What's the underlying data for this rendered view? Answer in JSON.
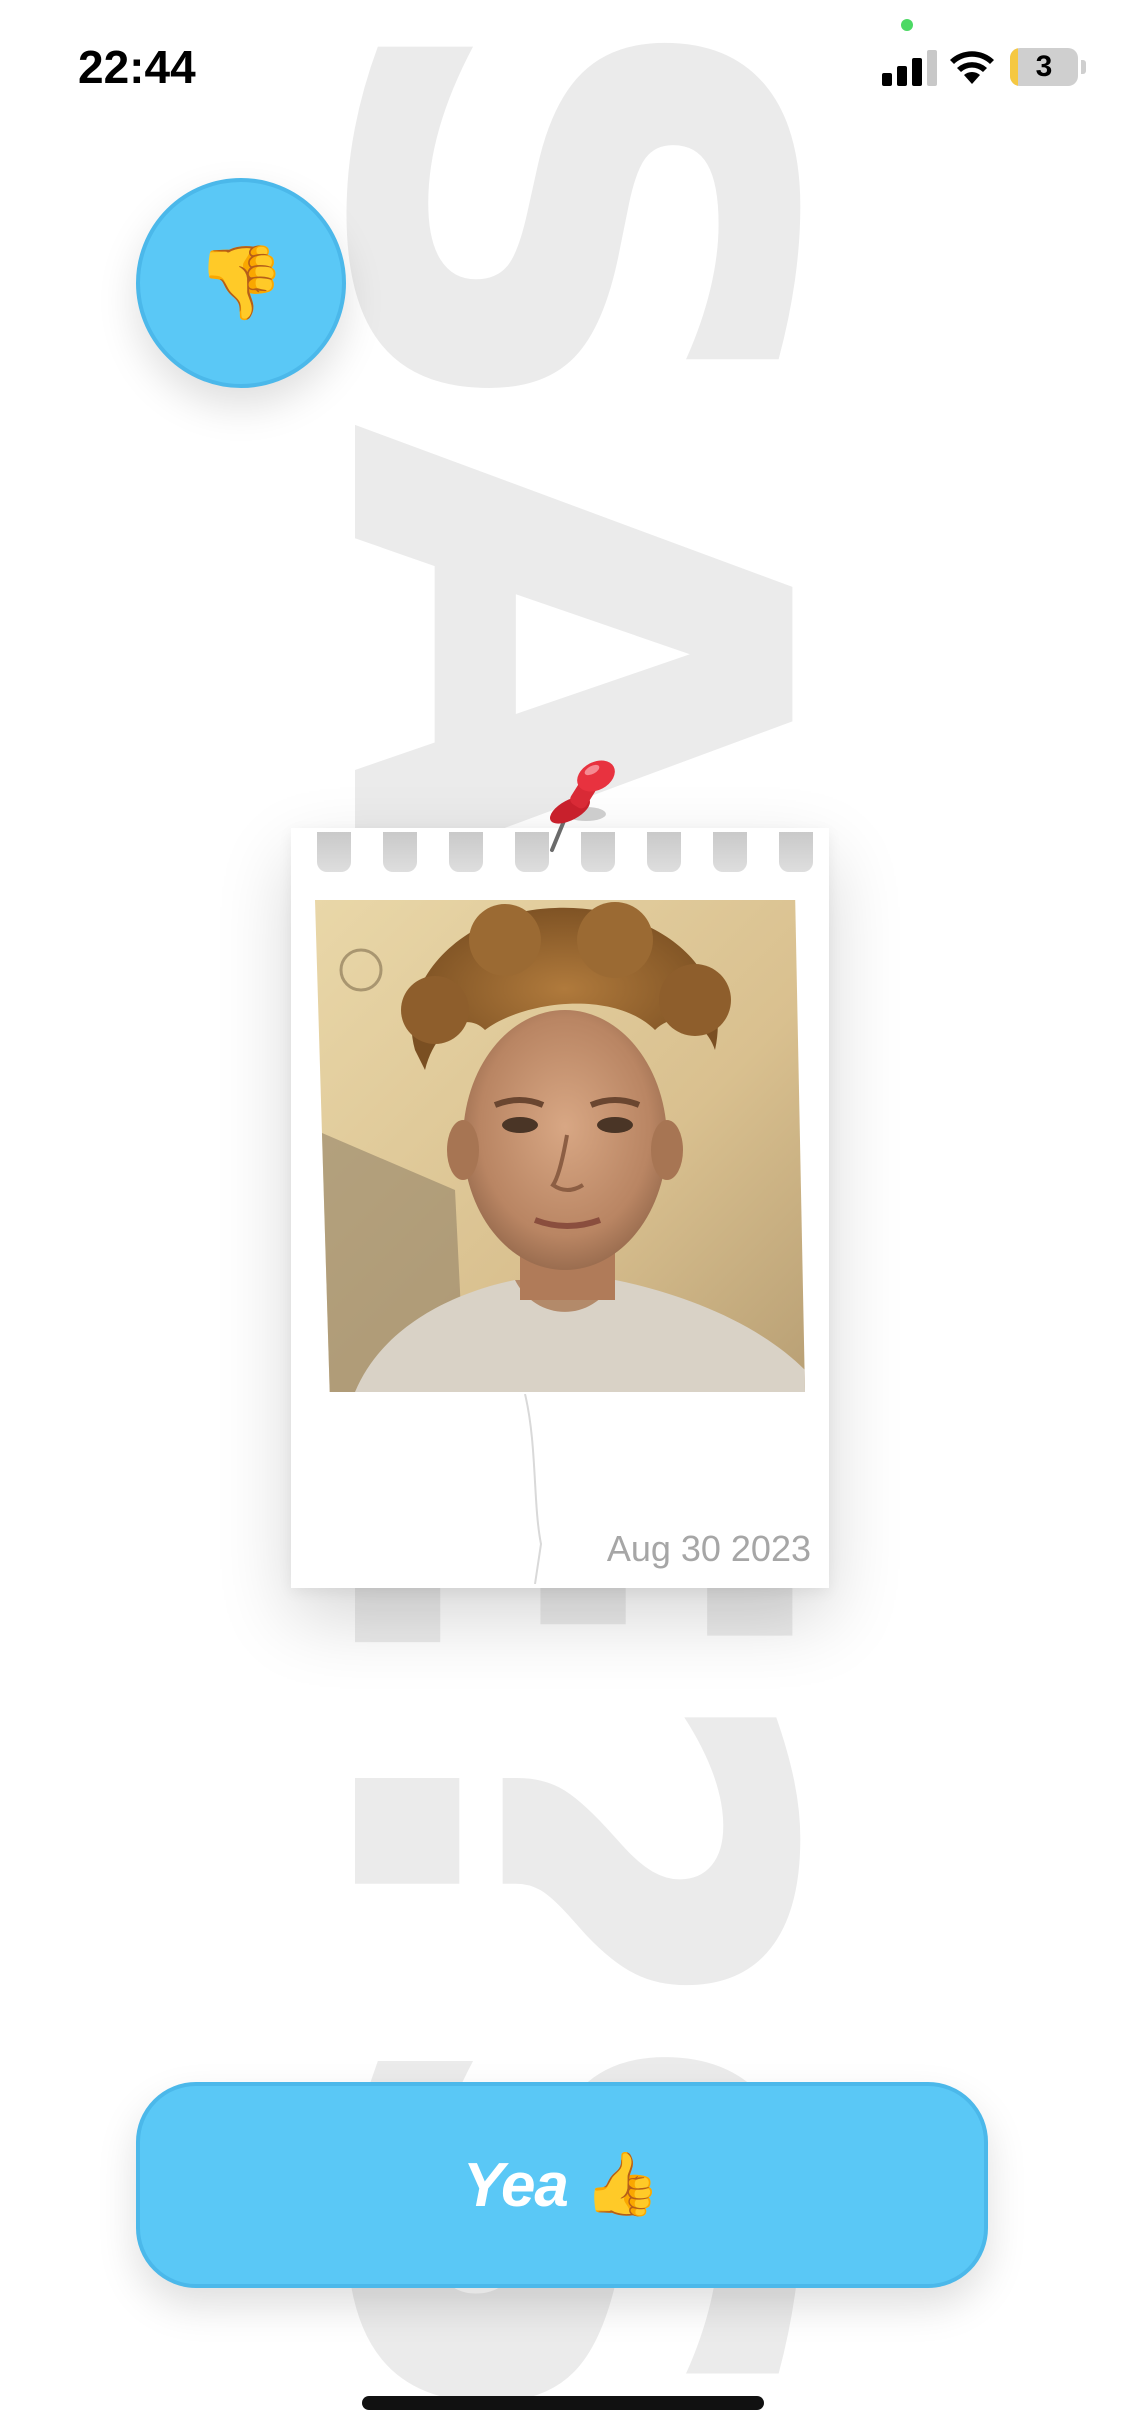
{
  "status_bar": {
    "time": "22:44",
    "battery_level": "3",
    "battery_fraction": 0.12,
    "privacy_dot_color": "#4cd964",
    "signal_bars_active": 3,
    "icons": [
      "cellular-signal-icon",
      "wifi-icon",
      "battery-icon"
    ]
  },
  "background": {
    "word": "SAFE?S"
  },
  "dislike_button": {
    "emoji": "👎",
    "icon": "thumbs-down-icon"
  },
  "polaroid": {
    "date": "Aug 30 2023",
    "pin_icon": "pushpin-icon"
  },
  "like_button": {
    "label": "Yea",
    "emoji": "👍",
    "icon": "thumbs-up-icon"
  },
  "colors": {
    "accent": "#5ac8f6",
    "accent_border": "#4bb8ea",
    "background_word": "#ebebeb",
    "date_text": "#a6a6a6"
  }
}
